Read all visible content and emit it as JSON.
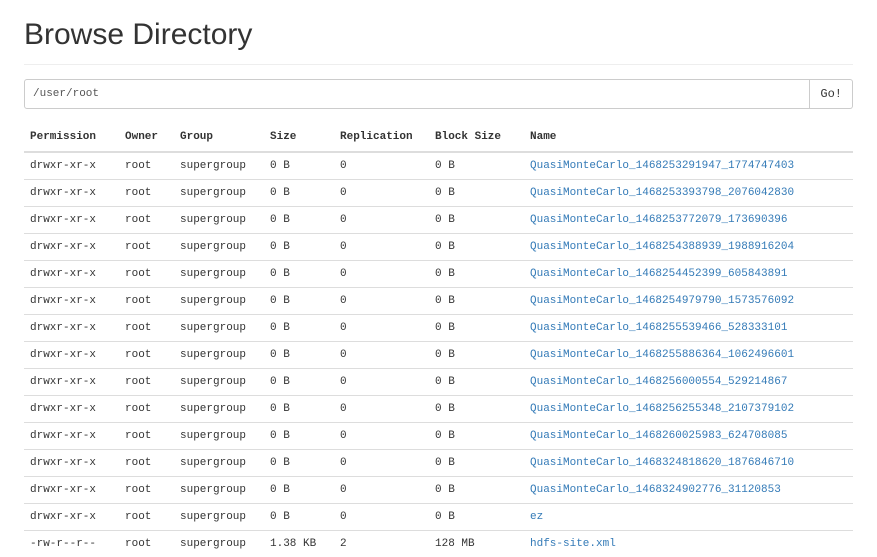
{
  "header": {
    "title": "Browse Directory"
  },
  "path_bar": {
    "value": "/user/root",
    "go_label": "Go!"
  },
  "table": {
    "headers": {
      "permission": "Permission",
      "owner": "Owner",
      "group": "Group",
      "size": "Size",
      "replication": "Replication",
      "block_size": "Block Size",
      "name": "Name"
    },
    "rows": [
      {
        "permission": "drwxr-xr-x",
        "owner": "root",
        "group": "supergroup",
        "size": "0 B",
        "replication": "0",
        "block_size": "0 B",
        "name": "QuasiMonteCarlo_1468253291947_1774747403"
      },
      {
        "permission": "drwxr-xr-x",
        "owner": "root",
        "group": "supergroup",
        "size": "0 B",
        "replication": "0",
        "block_size": "0 B",
        "name": "QuasiMonteCarlo_1468253393798_2076042830"
      },
      {
        "permission": "drwxr-xr-x",
        "owner": "root",
        "group": "supergroup",
        "size": "0 B",
        "replication": "0",
        "block_size": "0 B",
        "name": "QuasiMonteCarlo_1468253772079_173690396"
      },
      {
        "permission": "drwxr-xr-x",
        "owner": "root",
        "group": "supergroup",
        "size": "0 B",
        "replication": "0",
        "block_size": "0 B",
        "name": "QuasiMonteCarlo_1468254388939_1988916204"
      },
      {
        "permission": "drwxr-xr-x",
        "owner": "root",
        "group": "supergroup",
        "size": "0 B",
        "replication": "0",
        "block_size": "0 B",
        "name": "QuasiMonteCarlo_1468254452399_605843891"
      },
      {
        "permission": "drwxr-xr-x",
        "owner": "root",
        "group": "supergroup",
        "size": "0 B",
        "replication": "0",
        "block_size": "0 B",
        "name": "QuasiMonteCarlo_1468254979790_1573576092"
      },
      {
        "permission": "drwxr-xr-x",
        "owner": "root",
        "group": "supergroup",
        "size": "0 B",
        "replication": "0",
        "block_size": "0 B",
        "name": "QuasiMonteCarlo_1468255539466_528333101"
      },
      {
        "permission": "drwxr-xr-x",
        "owner": "root",
        "group": "supergroup",
        "size": "0 B",
        "replication": "0",
        "block_size": "0 B",
        "name": "QuasiMonteCarlo_1468255886364_1062496601"
      },
      {
        "permission": "drwxr-xr-x",
        "owner": "root",
        "group": "supergroup",
        "size": "0 B",
        "replication": "0",
        "block_size": "0 B",
        "name": "QuasiMonteCarlo_1468256000554_529214867"
      },
      {
        "permission": "drwxr-xr-x",
        "owner": "root",
        "group": "supergroup",
        "size": "0 B",
        "replication": "0",
        "block_size": "0 B",
        "name": "QuasiMonteCarlo_1468256255348_2107379102"
      },
      {
        "permission": "drwxr-xr-x",
        "owner": "root",
        "group": "supergroup",
        "size": "0 B",
        "replication": "0",
        "block_size": "0 B",
        "name": "QuasiMonteCarlo_1468260025983_624708085"
      },
      {
        "permission": "drwxr-xr-x",
        "owner": "root",
        "group": "supergroup",
        "size": "0 B",
        "replication": "0",
        "block_size": "0 B",
        "name": "QuasiMonteCarlo_1468324818620_1876846710"
      },
      {
        "permission": "drwxr-xr-x",
        "owner": "root",
        "group": "supergroup",
        "size": "0 B",
        "replication": "0",
        "block_size": "0 B",
        "name": "QuasiMonteCarlo_1468324902776_31120853"
      },
      {
        "permission": "drwxr-xr-x",
        "owner": "root",
        "group": "supergroup",
        "size": "0 B",
        "replication": "0",
        "block_size": "0 B",
        "name": "ez"
      },
      {
        "permission": "-rw-r--r--",
        "owner": "root",
        "group": "supergroup",
        "size": "1.38 KB",
        "replication": "2",
        "block_size": "128 MB",
        "name": "hdfs-site.xml"
      }
    ]
  }
}
